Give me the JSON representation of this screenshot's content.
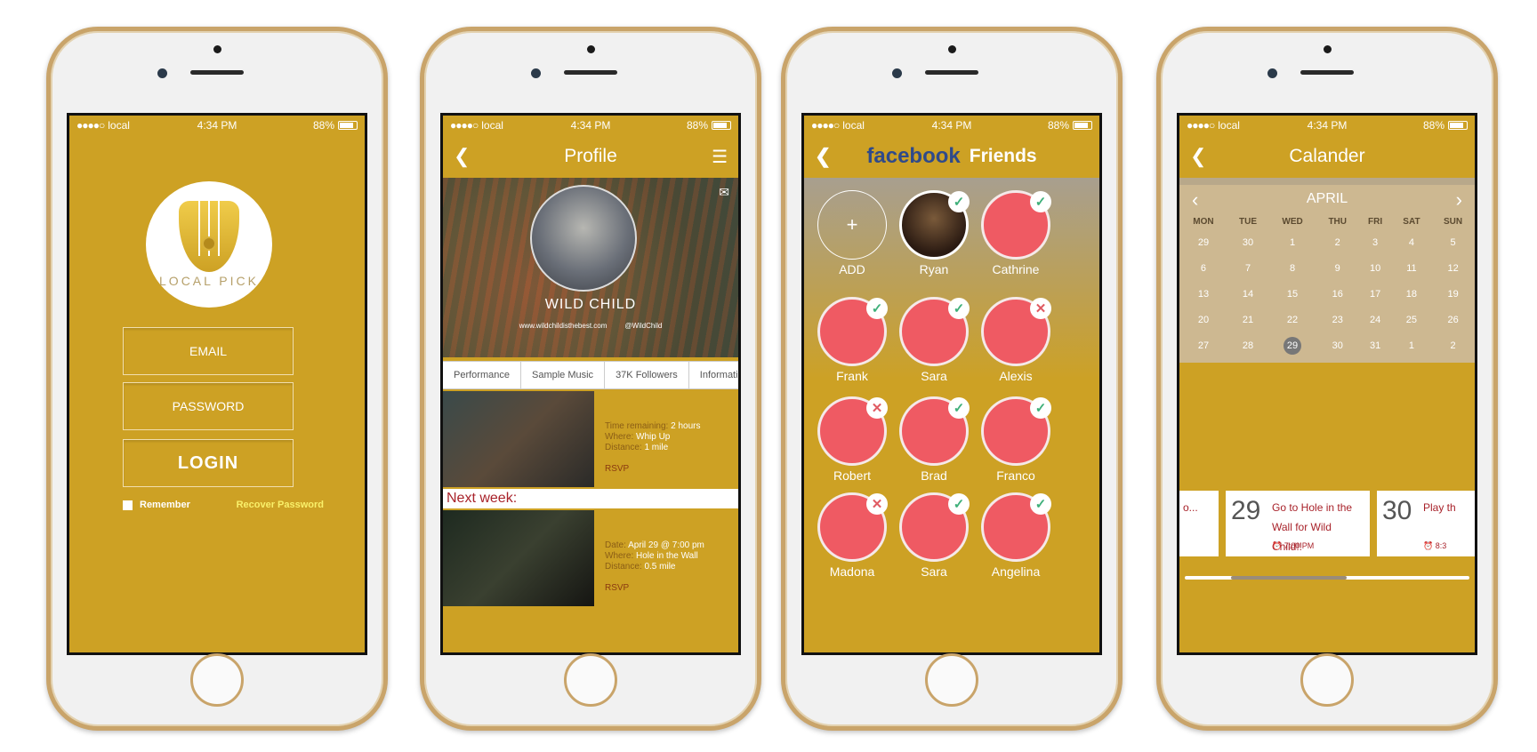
{
  "status": {
    "carrier": "local",
    "time": "4:34 PM",
    "battery": "88%"
  },
  "screen1": {
    "logo_text": "LOCAL PICK",
    "email_placeholder": "EMAIL",
    "password_placeholder": "PASSWORD",
    "login_label": "LOGIN",
    "remember_label": "Remember",
    "recover_label": "Recover Password"
  },
  "screen2": {
    "title": "Profile",
    "band_name": "WILD CHILD",
    "website": "www.wildchildisthebest.com",
    "twitter": "@WildChild",
    "tabs": [
      "Performance",
      "Sample Music",
      "37K Followers",
      "Information"
    ],
    "event1": {
      "time_label": "Time remaining:",
      "time_value": "2 hours",
      "where_label": "Where:",
      "where_value": "Whip Up",
      "distance_label": "Distance:",
      "distance_value": "1 mile",
      "rsvp": "RSVP"
    },
    "next_week": "Next week:",
    "event2": {
      "date_label": "Date:",
      "date_value": "April 29 @ 7:00 pm",
      "where_label": "Where:",
      "where_value": "Hole in the Wall",
      "distance_label": "Distance:",
      "distance_value": "0.5 mile",
      "rsvp": "RSVP"
    }
  },
  "screen3": {
    "title_brand": "facebook",
    "title": "Friends",
    "add_label": "ADD",
    "friends": [
      {
        "name": "Ryan",
        "status": "ok"
      },
      {
        "name": "Cathrine",
        "status": "ok"
      },
      {
        "name": "Frank",
        "status": "ok"
      },
      {
        "name": "Sara",
        "status": "ok"
      },
      {
        "name": "Alexis",
        "status": "no"
      },
      {
        "name": "Robert",
        "status": "no"
      },
      {
        "name": "Brad",
        "status": "ok"
      },
      {
        "name": "Franco",
        "status": "ok"
      },
      {
        "name": "Madona",
        "status": "no"
      },
      {
        "name": "Sara",
        "status": "ok"
      },
      {
        "name": "Angelina",
        "status": "ok"
      }
    ]
  },
  "screen4": {
    "title": "Calander",
    "month": "APRIL",
    "weekdays": [
      "MON",
      "TUE",
      "WED",
      "THU",
      "FRI",
      "SAT",
      "SUN"
    ],
    "weeks": [
      [
        "29",
        "30",
        "1",
        "2",
        "3",
        "4",
        "5"
      ],
      [
        "6",
        "7",
        "8",
        "9",
        "10",
        "11",
        "12"
      ],
      [
        "13",
        "14",
        "15",
        "16",
        "17",
        "18",
        "19"
      ],
      [
        "20",
        "21",
        "22",
        "23",
        "24",
        "25",
        "26"
      ],
      [
        "27",
        "28",
        "29",
        "30",
        "31",
        "1",
        "2"
      ]
    ],
    "selected": "29",
    "cards": [
      {
        "day": "",
        "text": "o...",
        "time": ""
      },
      {
        "day": "29",
        "text": "Go to Hole in the Wall for Wild Child!!",
        "time": "7:00 PM"
      },
      {
        "day": "30",
        "text": "Play th",
        "time": "8:3"
      }
    ]
  }
}
